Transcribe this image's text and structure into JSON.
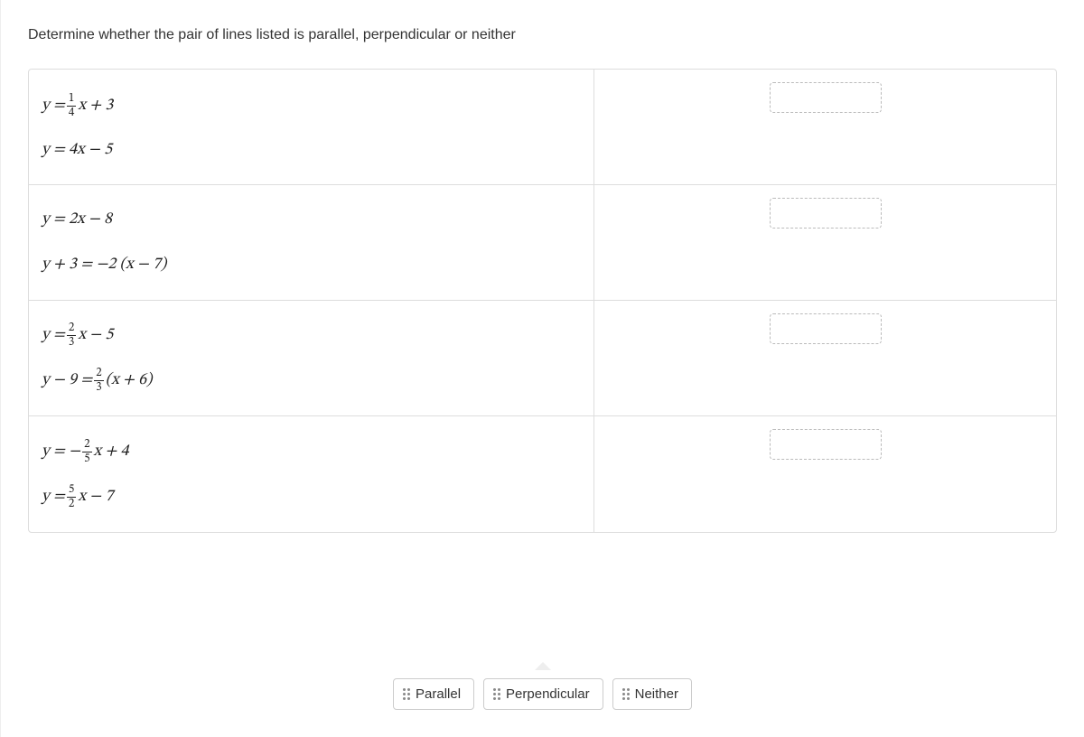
{
  "prompt": "Determine whether the pair of lines listed is parallel, perpendicular or neither",
  "rows": [
    {
      "eq1": {
        "pre": "y = ",
        "frac": {
          "n": "1",
          "d": "4"
        },
        "post": "x + 3"
      },
      "eq2": {
        "pre": "y = 4x − 5"
      }
    },
    {
      "eq1": {
        "pre": "y = 2x − 8"
      },
      "eq2": {
        "pre": "y + 3 = −2 (x − 7)"
      }
    },
    {
      "eq1": {
        "pre": "y = ",
        "frac": {
          "n": "2",
          "d": "3"
        },
        "post": "x − 5"
      },
      "eq2": {
        "pre": "y − 9 = ",
        "frac": {
          "n": "2",
          "d": "3"
        },
        "post": "(x + 6)"
      }
    },
    {
      "eq1": {
        "pre": "y = −",
        "frac": {
          "n": "2",
          "d": "5"
        },
        "post": "x + 4"
      },
      "eq2": {
        "pre": "y = ",
        "frac": {
          "n": "5",
          "d": "2"
        },
        "post": "x − 7"
      }
    }
  ],
  "options": {
    "a": "Parallel",
    "b": "Perpendicular",
    "c": "Neither"
  }
}
